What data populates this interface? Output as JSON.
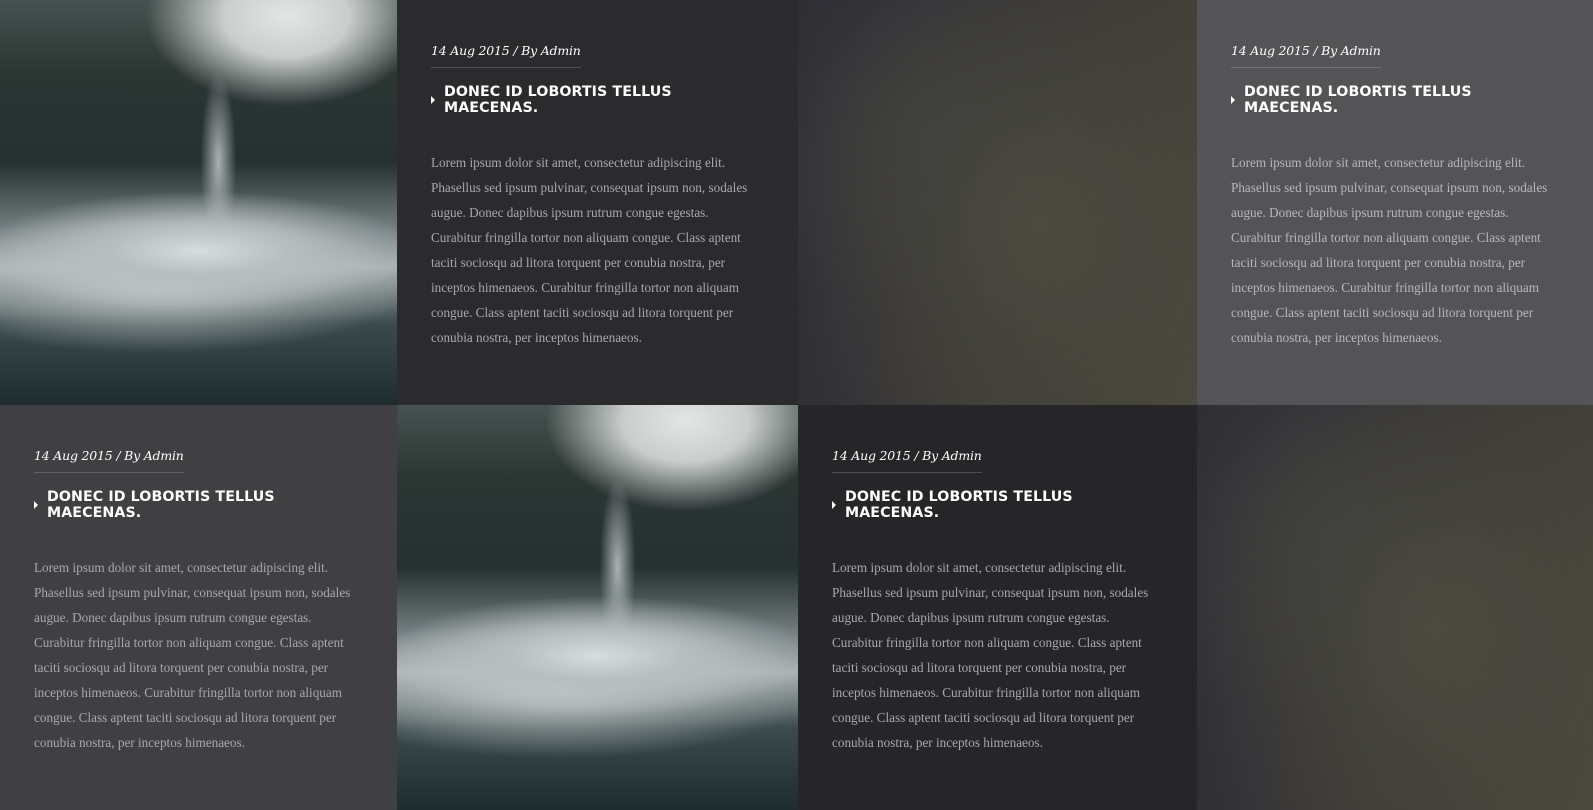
{
  "posts": [
    {
      "meta": "14 Aug 2015 / By Admin",
      "title": "DONEC ID LOBORTIS TELLUS MAECENAS.",
      "body": "Lorem ipsum dolor sit amet, consectetur adipiscing elit. Phasellus sed ipsum pulvinar, consequat ipsum non, sodales augue. Donec dapibus ipsum rutrum congue egestas. Curabitur fringilla tortor non aliquam congue. Class aptent taciti sociosqu ad litora torquent per conubia nostra, per inceptos himenaeos. Curabitur fringilla tortor non aliquam congue. Class aptent taciti sociosqu ad litora torquent per conubia nostra, per inceptos himenaeos."
    },
    {
      "meta": "14 Aug 2015 / By Admin",
      "title": "DONEC ID LOBORTIS TELLUS MAECENAS.",
      "body": "Lorem ipsum dolor sit amet, consectetur adipiscing elit. Phasellus sed ipsum pulvinar, consequat ipsum non, sodales augue. Donec dapibus ipsum rutrum congue egestas. Curabitur fringilla tortor non aliquam congue. Class aptent taciti sociosqu ad litora torquent per conubia nostra, per inceptos himenaeos. Curabitur fringilla tortor non aliquam congue. Class aptent taciti sociosqu ad litora torquent per conubia nostra, per inceptos himenaeos."
    },
    {
      "meta": "14 Aug 2015 / By Admin",
      "title": "DONEC ID LOBORTIS TELLUS MAECENAS.",
      "body": "Lorem ipsum dolor sit amet, consectetur adipiscing elit. Phasellus sed ipsum pulvinar, consequat ipsum non, sodales augue. Donec dapibus ipsum rutrum congue egestas. Curabitur fringilla tortor non aliquam congue. Class aptent taciti sociosqu ad litora torquent per conubia nostra, per inceptos himenaeos. Curabitur fringilla tortor non aliquam congue. Class aptent taciti sociosqu ad litora torquent per conubia nostra, per inceptos himenaeos."
    },
    {
      "meta": "14 Aug 2015 / By Admin",
      "title": "DONEC ID LOBORTIS TELLUS MAECENAS.",
      "body": "Lorem ipsum dolor sit amet, consectetur adipiscing elit. Phasellus sed ipsum pulvinar, consequat ipsum non, sodales augue. Donec dapibus ipsum rutrum congue egestas. Curabitur fringilla tortor non aliquam congue. Class aptent taciti sociosqu ad litora torquent per conubia nostra, per inceptos himenaeos. Curabitur fringilla tortor non aliquam congue. Class aptent taciti sociosqu ad litora torquent per conubia nostra, per inceptos himenaeos."
    }
  ],
  "colors": {
    "card_dark": "#2b2b2d",
    "card_darker": "#262628",
    "card_mid": "#404042",
    "card_light": "#545456",
    "text_white": "#ffffff",
    "text_body": "#a9a9ab"
  },
  "icons": {
    "title_bullet": "caret-right-icon"
  }
}
